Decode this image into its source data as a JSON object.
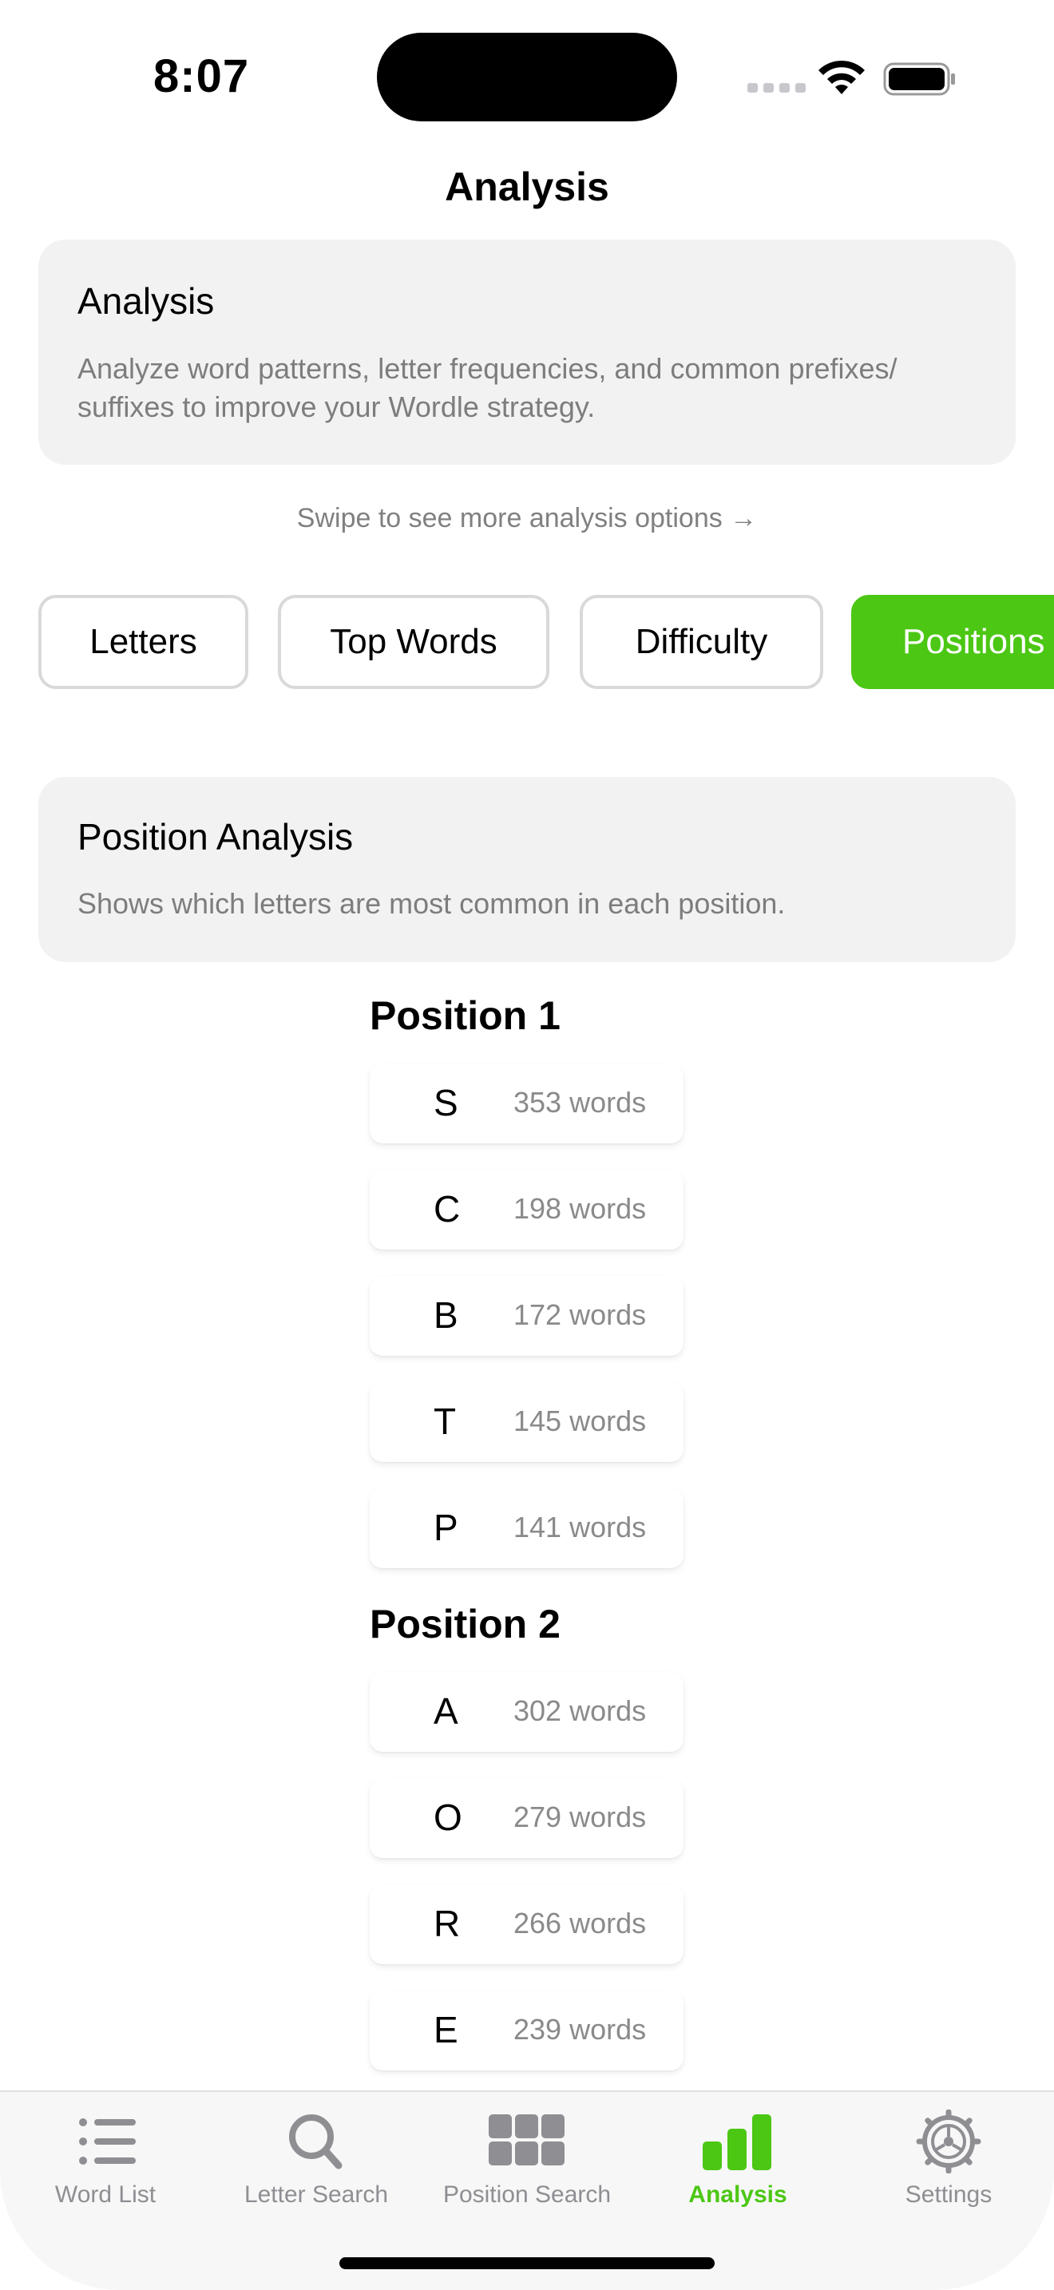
{
  "status_bar": {
    "time": "8:07"
  },
  "nav": {
    "title": "Analysis"
  },
  "intro_card": {
    "title": "Analysis",
    "text": "Analyze word patterns, letter frequencies, and common prefixes/ suffixes to improve your Wordle strategy."
  },
  "swipe_hint": "Swipe to see more analysis options →",
  "analysis_tabs": [
    {
      "label": "Letters",
      "active": false
    },
    {
      "label": "Top Words",
      "active": false
    },
    {
      "label": "Difficulty",
      "active": false
    },
    {
      "label": "Positions",
      "active": true
    }
  ],
  "position_card": {
    "title": "Position Analysis",
    "text": "Shows which letters are most common in each position."
  },
  "positions": [
    {
      "heading": "Position 1",
      "rows": [
        {
          "letter": "S",
          "count": "353 words"
        },
        {
          "letter": "C",
          "count": "198 words"
        },
        {
          "letter": "B",
          "count": "172 words"
        },
        {
          "letter": "T",
          "count": "145 words"
        },
        {
          "letter": "P",
          "count": "141 words"
        }
      ]
    },
    {
      "heading": "Position 2",
      "rows": [
        {
          "letter": "A",
          "count": "302 words"
        },
        {
          "letter": "O",
          "count": "279 words"
        },
        {
          "letter": "R",
          "count": "266 words"
        },
        {
          "letter": "E",
          "count": "239 words"
        }
      ]
    }
  ],
  "tab_bar": [
    {
      "label": "Word List",
      "icon": "list-icon",
      "active": false
    },
    {
      "label": "Letter Search",
      "icon": "magnifier-icon",
      "active": false
    },
    {
      "label": "Position Search",
      "icon": "grid-icon",
      "active": false
    },
    {
      "label": "Analysis",
      "icon": "bar-chart-icon",
      "active": true
    },
    {
      "label": "Settings",
      "icon": "gear-icon",
      "active": false
    }
  ],
  "colors": {
    "accent": "#4cc714",
    "card_bg": "#f2f2f2",
    "muted_text": "#808080",
    "tab_inactive": "#8e8e93"
  }
}
